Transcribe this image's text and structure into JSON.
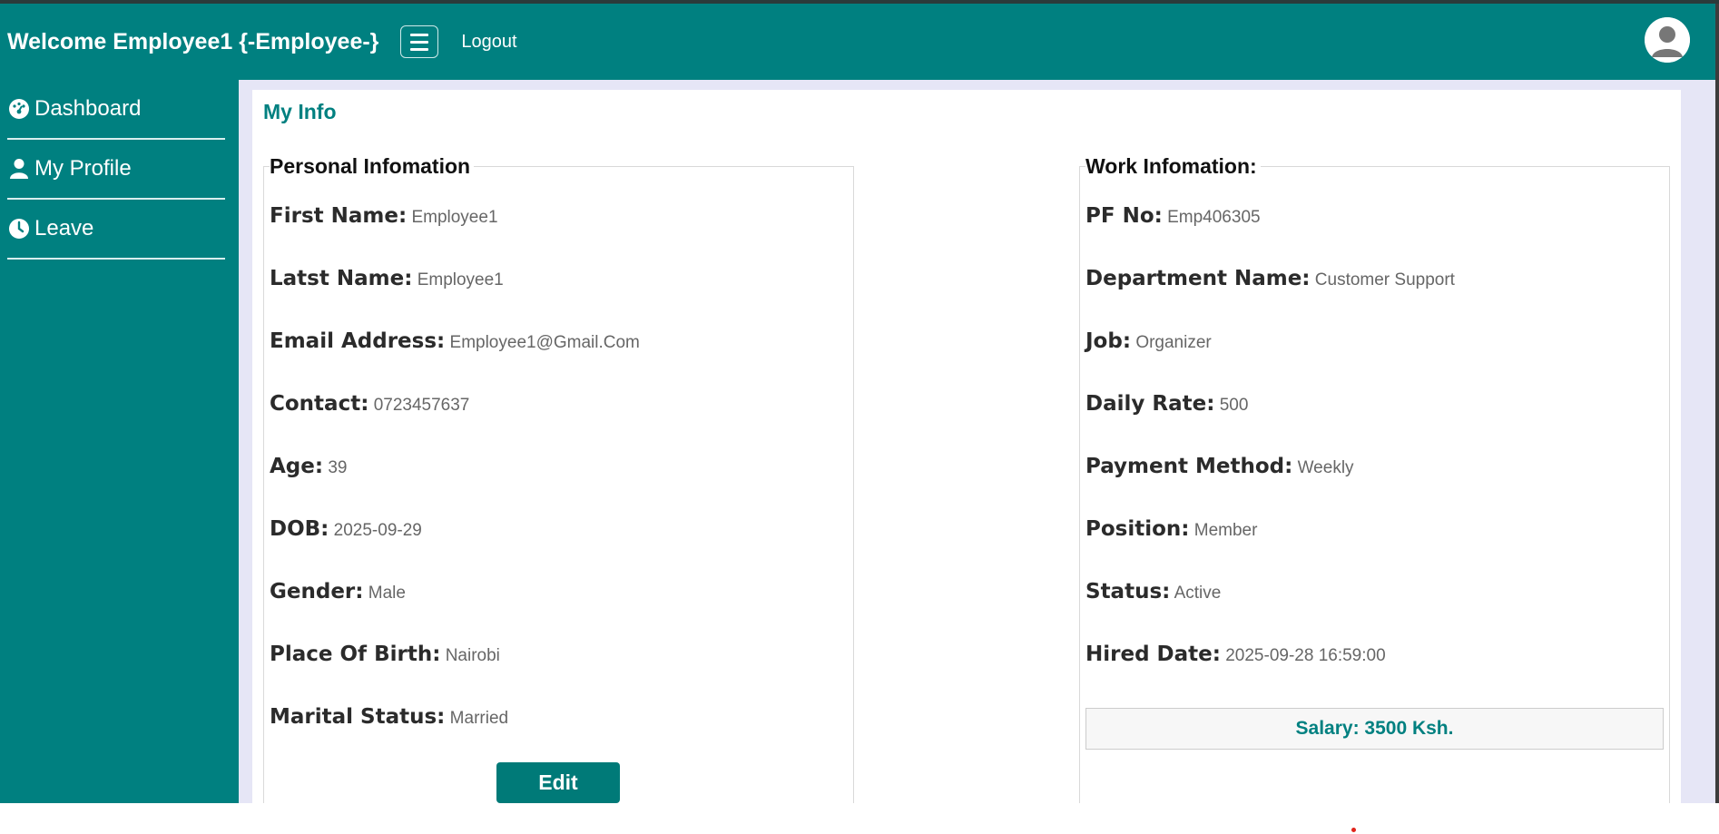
{
  "header": {
    "welcome": "Welcome Employee1 {-Employee-}",
    "logout": "Logout",
    "menu_icon": "hamburger-icon",
    "avatar_icon": "user-avatar-icon"
  },
  "sidebar": {
    "items": [
      {
        "label": "Dashboard",
        "icon": "dashboard-icon"
      },
      {
        "label": "My Profile",
        "icon": "user-icon"
      },
      {
        "label": "Leave",
        "icon": "clock-icon"
      }
    ]
  },
  "main": {
    "title": "My Info",
    "personal": {
      "legend": "Personal Infomation",
      "rows": [
        {
          "label": "First Name:",
          "value": "Employee1"
        },
        {
          "label": "Latst Name:",
          "value": "Employee1"
        },
        {
          "label": "Email Address:",
          "value": "Employee1@Gmail.Com"
        },
        {
          "label": "Contact:",
          "value": "0723457637"
        },
        {
          "label": "Age:",
          "value": "39"
        },
        {
          "label": "DOB:",
          "value": "2025-09-29"
        },
        {
          "label": "Gender:",
          "value": "Male"
        },
        {
          "label": "Place Of Birth:",
          "value": "Nairobi"
        },
        {
          "label": "Marital Status:",
          "value": "Married"
        }
      ],
      "edit_label": "Edit"
    },
    "work": {
      "legend": "Work Infomation:",
      "rows": [
        {
          "label": "PF No:",
          "value": "Emp406305"
        },
        {
          "label": "Department Name:",
          "value": "Customer Support"
        },
        {
          "label": "Job:",
          "value": "Organizer"
        },
        {
          "label": "Daily Rate:",
          "value": "500"
        },
        {
          "label": "Payment Method:",
          "value": "Weekly"
        },
        {
          "label": "Position:",
          "value": "Member"
        },
        {
          "label": "Status:",
          "value": "Active"
        },
        {
          "label": "Hired Date:",
          "value": "2025-09-28 16:59:00"
        }
      ],
      "salary": "Salary: 3500 Ksh."
    }
  },
  "colors": {
    "brand": "#008080",
    "page_bg": "#e6e6f6",
    "salary_text": "#008080"
  }
}
